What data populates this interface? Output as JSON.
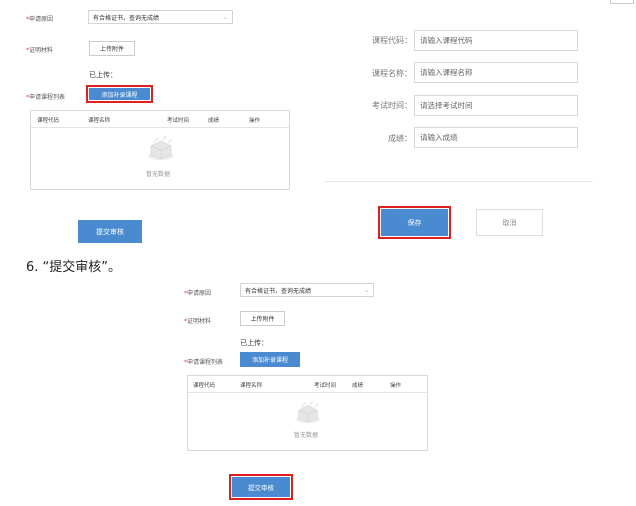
{
  "top": {
    "reason_label": "*申请原因",
    "reason_value": "有合格证书，查询无成绩",
    "material_label": "*证明材料",
    "upload_button": "上传附件",
    "uploaded_label": "已上传：",
    "course_list_label": "*申请课程列表",
    "add_course_button": "添加补录课程",
    "table_columns": [
      "课程代码",
      "课程名称",
      "考试时间",
      "成绩",
      "操作"
    ],
    "empty_text": "暂无数据",
    "submit_button": "提交审核"
  },
  "form": {
    "course_code_label": "课程代码：",
    "course_code_placeholder": "请输入课程代码",
    "course_name_label": "课程名称：",
    "course_name_placeholder": "请输入课程名称",
    "exam_time_label": "考试时间：",
    "exam_time_placeholder": "请选择考试时间",
    "score_label": "成绩：",
    "score_placeholder": "请输入成绩",
    "save_button": "保存",
    "cancel_button": "取消"
  },
  "step_caption": "6. “提交审核”。",
  "bottom": {
    "reason_label": "*申请原因",
    "reason_value": "有合格证书，查询无成绩",
    "material_label": "*证明材料",
    "upload_button": "上传附件",
    "uploaded_label": "已上传：",
    "course_list_label": "*申请课程列表",
    "add_course_button": "添加补录课程",
    "table_columns": [
      "课程代码",
      "课程名称",
      "考试时间",
      "成绩",
      "操作"
    ],
    "empty_text": "暂无数据",
    "submit_button": "提交审核"
  },
  "colors": {
    "accent_blue": "#4a8ad0",
    "highlight_red": "#e02020"
  }
}
